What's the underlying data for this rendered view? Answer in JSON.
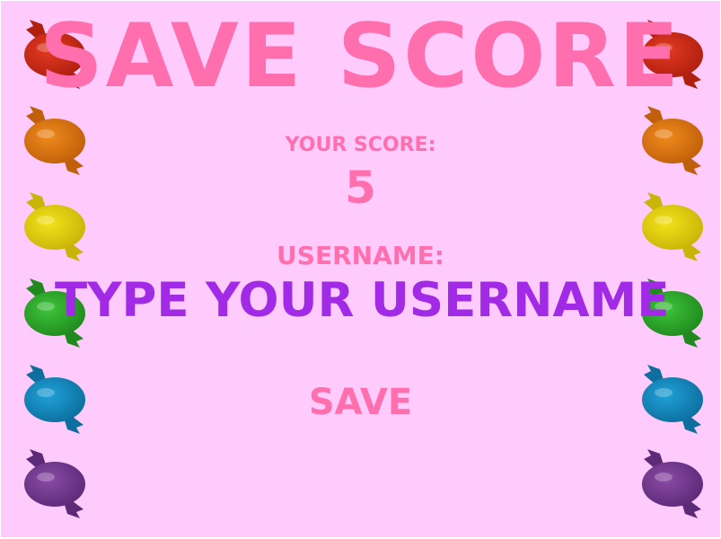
{
  "screen": {
    "title": "SAVE SCORE",
    "score_label": "YOUR SCORE:",
    "score_value": "5",
    "username_label": "USERNAME:",
    "username_placeholder": "TYPE YOUR USERNAME",
    "username_value": "",
    "save_label": "SAVE"
  },
  "colors": {
    "background": "#ffcbfd",
    "title_pink": "#ff6fae",
    "input_purple": "#a12ae6"
  },
  "candies": {
    "left": [
      {
        "icon": "red-candy-icon",
        "color": "#e43a22",
        "dark": "#b0200e"
      },
      {
        "icon": "orange-candy-icon",
        "color": "#f08a1c",
        "dark": "#c0600a"
      },
      {
        "icon": "yellow-candy-icon",
        "color": "#f4e21a",
        "dark": "#c9b408"
      },
      {
        "icon": "green-candy-icon",
        "color": "#3ec43a",
        "dark": "#208a1e"
      },
      {
        "icon": "blue-candy-icon",
        "color": "#1fa1d8",
        "dark": "#0d6f9e"
      },
      {
        "icon": "purple-candy-icon",
        "color": "#8a4ba6",
        "dark": "#5d2a78"
      }
    ],
    "right": [
      {
        "icon": "red-candy-icon",
        "color": "#e43a22",
        "dark": "#b0200e"
      },
      {
        "icon": "orange-candy-icon",
        "color": "#f08a1c",
        "dark": "#c0600a"
      },
      {
        "icon": "yellow-candy-icon",
        "color": "#f4e21a",
        "dark": "#c9b408"
      },
      {
        "icon": "green-candy-icon",
        "color": "#3ec43a",
        "dark": "#208a1e"
      },
      {
        "icon": "blue-candy-icon",
        "color": "#1fa1d8",
        "dark": "#0d6f9e"
      },
      {
        "icon": "purple-candy-icon",
        "color": "#8a4ba6",
        "dark": "#5d2a78"
      }
    ]
  }
}
